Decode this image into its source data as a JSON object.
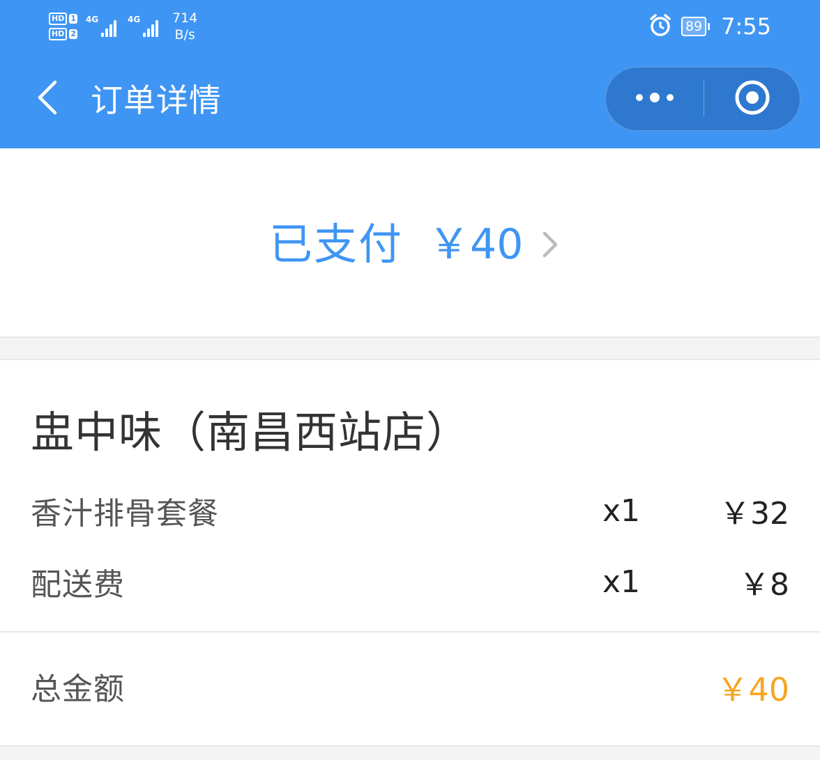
{
  "status_bar": {
    "sim1": {
      "hd": "HD",
      "slot": "1",
      "network": "4G"
    },
    "sim2": {
      "hd": "HD",
      "slot": "2",
      "network": "4G"
    },
    "speed_value": "714",
    "speed_unit": "B/s",
    "battery": "89",
    "time": "7:55",
    "icons": [
      "alarm-icon",
      "battery-icon",
      "signal-icon"
    ]
  },
  "nav": {
    "title": "订单详情",
    "background": "#3f95f3"
  },
  "payment": {
    "status": "已支付",
    "amount": "￥40",
    "accent_color": "#3f95f3"
  },
  "order": {
    "store_name": "盅中味（南昌西站店）",
    "items": [
      {
        "name": "香汁排骨套餐",
        "qty": "x1",
        "price": "￥32"
      },
      {
        "name": "配送费",
        "qty": "x1",
        "price": "￥8"
      }
    ]
  },
  "total": {
    "label": "总金额",
    "value": "￥40",
    "color": "#f5a623"
  }
}
